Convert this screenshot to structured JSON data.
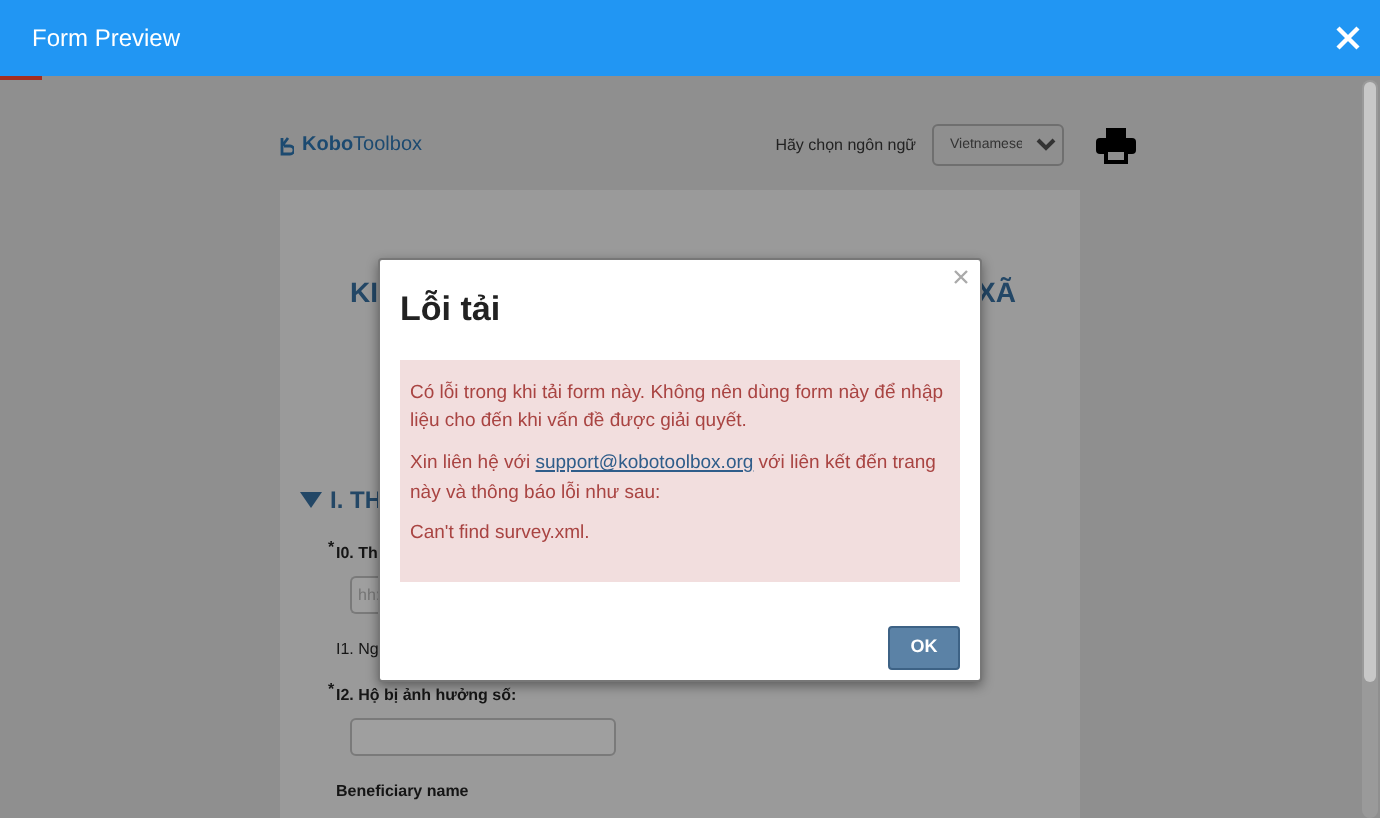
{
  "window": {
    "title": "Form Preview"
  },
  "progress": {
    "level": 0.03
  },
  "form": {
    "logo": "**Kobo**Toolbox",
    "language_label": "Hãy chọn ngôn ngữ",
    "language_value": "Vietnamese",
    "title_fragments": [
      "KI",
      "XÃ"
    ],
    "section": {
      "label": "I. TH",
      "expanded": true
    },
    "questions": [
      {
        "kind": "input",
        "marker": "*",
        "label": "I0. Th",
        "placeholder": "hh:"
      },
      {
        "kind": "note",
        "label": "I1. Ng"
      },
      {
        "kind": "input",
        "marker": "*",
        "label": "I2. Hộ bị ảnh hưởng số:"
      },
      {
        "kind": "heading",
        "label": "Beneficiary name"
      }
    ]
  },
  "dialog": {
    "title": "Lỗi tải",
    "paragraphs": [
      {
        "text": "Có lỗi trong khi tải form này. Không nên dùng form này để nhập liệu cho đến khi vấn đề được giải quyết."
      },
      {
        "before": "Xin liên hệ với ",
        "link": "support@kobotoolbox.org",
        "after": " với liên kết đến trang này và thông báo lỗi như sau:"
      },
      {
        "text": "Can't find survey.xml."
      }
    ],
    "button": "OK"
  }
}
